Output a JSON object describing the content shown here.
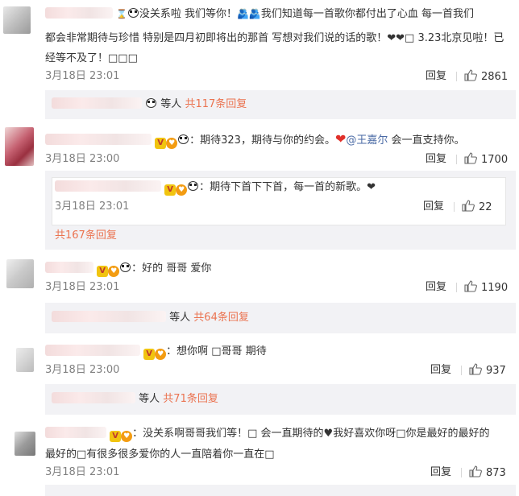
{
  "comments": [
    {
      "text_l1": "没关系啦 我们等你！",
      "text_l1b": "我们知道每一首歌你都付出了心血 每一首我们",
      "text_l2": "都会非常期待与珍惜 特别是四月初即将出的那首 写想对我们说的话的歌！❤❤□ 3.23北京见啦！已",
      "text_l3": "经等不及了！□□□",
      "time": "3月18日 23:01",
      "reply": "回复",
      "likes": "2861",
      "more_suffix": "等人",
      "more_count": "共117条回复"
    },
    {
      "text_pre": "：期待323，期待与你的约会。",
      "mention": "@王嘉尔",
      "text_post": "会一直支持你。",
      "time": "3月18日 23:00",
      "reply": "回复",
      "likes": "1700",
      "sub_text": "：期待下首下下首，每一首的新歌。❤",
      "sub_time": "3月18日 23:01",
      "sub_reply": "回复",
      "sub_likes": "22",
      "total": "共167条回复"
    },
    {
      "text": "：好的 哥哥 爱你",
      "time": "3月18日 23:01",
      "reply": "回复",
      "likes": "1190",
      "more_suffix": "等人",
      "more_count": "共64条回复"
    },
    {
      "text": "：想你啊 □哥哥 期待",
      "time": "3月18日 23:00",
      "reply": "回复",
      "likes": "937",
      "more_suffix": "等人",
      "more_count": "共71条回复"
    },
    {
      "text_l1": "：没关系啊哥哥我们等！□ 会一直期待的♥我好喜欢你呀□你是最好的最好的",
      "text_l2": "最好的□有很多很多爱你的人一直陪着你一直在□",
      "time": "3月18日 23:01",
      "reply": "回复",
      "likes": "873"
    }
  ],
  "icons": {
    "thumb": "thumbs-up-icon",
    "panda": "panda-emoji-icon",
    "hug": "hug-emoji-icon"
  },
  "colors": {
    "accent": "#eb7350",
    "link": "#4a6aa5",
    "meta": "#808080"
  }
}
